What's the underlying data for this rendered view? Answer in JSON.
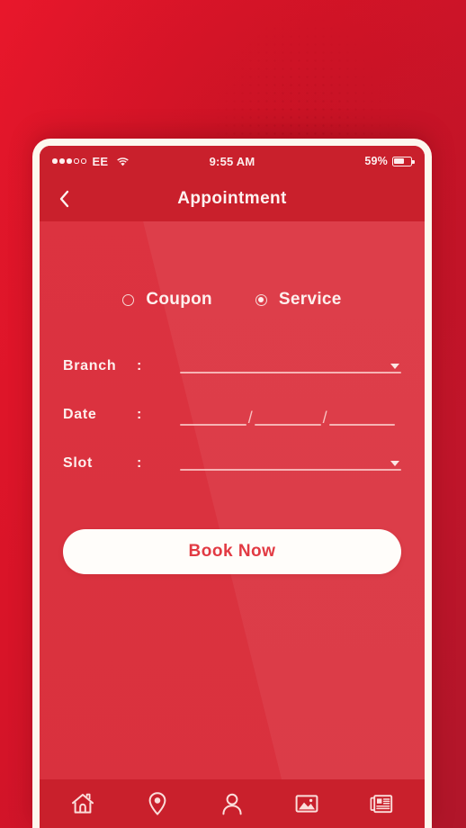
{
  "statusbar": {
    "signal_dots_filled": 3,
    "signal_dots_empty": 2,
    "carrier": "EE",
    "wifi_icon": "wifi-icon",
    "time": "9:55 AM",
    "battery_percent": "59%",
    "battery_level": 59
  },
  "header": {
    "back_icon": "chevron-left-icon",
    "title": "Appointment"
  },
  "options": {
    "items": [
      {
        "label": "Coupon",
        "selected": false
      },
      {
        "label": "Service",
        "selected": true
      }
    ]
  },
  "form": {
    "colon": ":",
    "rows": [
      {
        "label": "Branch",
        "type": "dropdown",
        "value": ""
      },
      {
        "label": "Date",
        "type": "date",
        "value": ""
      },
      {
        "label": "Slot",
        "type": "dropdown",
        "value": ""
      }
    ],
    "date_separator": "/"
  },
  "primary_action": {
    "label": "Book Now"
  },
  "bottom_nav": {
    "items": [
      {
        "icon": "home-icon",
        "name": "home"
      },
      {
        "icon": "location-pin-icon",
        "name": "locations"
      },
      {
        "icon": "person-icon",
        "name": "profile"
      },
      {
        "icon": "image-icon",
        "name": "gallery"
      },
      {
        "icon": "news-icon",
        "name": "news"
      }
    ]
  },
  "colors": {
    "brand_red": "#d41f2e",
    "header_red": "#c9202c",
    "screen_red": "#dc3340",
    "light_text": "#fdf0ee",
    "button_bg": "#fffdfa",
    "button_text": "#e23a43"
  }
}
